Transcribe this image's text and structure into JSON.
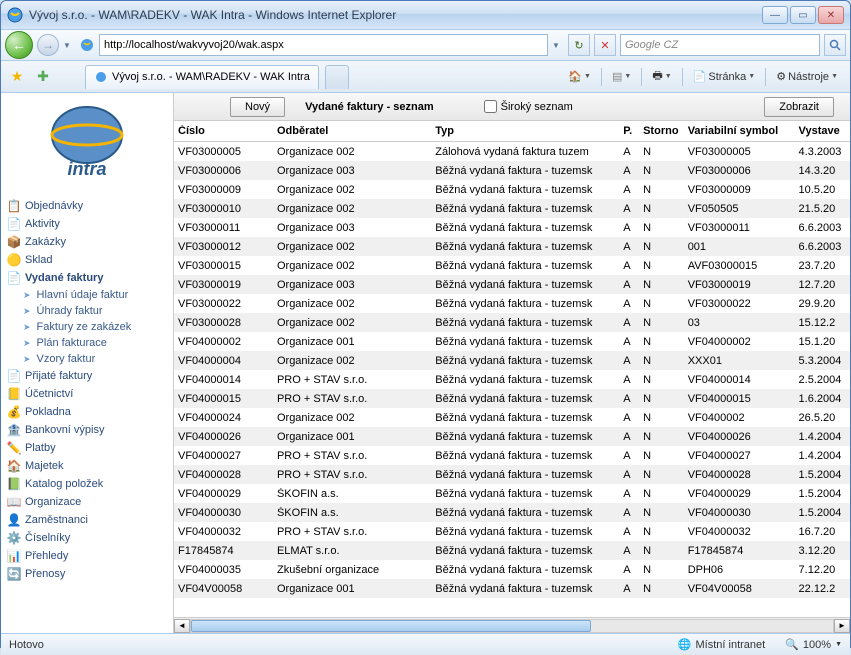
{
  "window": {
    "title": "Vývoj s.r.o. - WAM\\RADEKV - WAK Intra - Windows Internet Explorer"
  },
  "addressbar": {
    "url": "http://localhost/wakvyvoj20/wak.aspx",
    "search_placeholder": "Google CZ"
  },
  "tab": {
    "title": "Vývoj s.r.o. - WAM\\RADEKV - WAK Intra"
  },
  "ie_tools": {
    "stranka": "Stránka",
    "nastroje": "Nástroje"
  },
  "sidebar": {
    "items": [
      {
        "label": "Objednávky",
        "icon": "📋"
      },
      {
        "label": "Aktivity",
        "icon": "📄"
      },
      {
        "label": "Zakázky",
        "icon": "📦"
      },
      {
        "label": "Sklad",
        "icon": "🟡"
      },
      {
        "label": "Vydané faktury",
        "icon": "📄",
        "bold": true,
        "expanded": true,
        "children": [
          {
            "label": "Hlavní údaje faktur"
          },
          {
            "label": "Úhrady faktur"
          },
          {
            "label": "Faktury ze zakázek"
          },
          {
            "label": "Plán fakturace"
          },
          {
            "label": "Vzory faktur"
          }
        ]
      },
      {
        "label": "Přijaté faktury",
        "icon": "📄"
      },
      {
        "label": "Účetnictví",
        "icon": "📒"
      },
      {
        "label": "Pokladna",
        "icon": "💰"
      },
      {
        "label": "Bankovní výpisy",
        "icon": "🏦"
      },
      {
        "label": "Platby",
        "icon": "✏️"
      },
      {
        "label": "Majetek",
        "icon": "🏠"
      },
      {
        "label": "Katalog položek",
        "icon": "📗"
      },
      {
        "label": "Organizace",
        "icon": "📖"
      },
      {
        "label": "Zaměstnanci",
        "icon": "👤"
      },
      {
        "label": "Číselníky",
        "icon": "⚙️"
      },
      {
        "label": "Přehledy",
        "icon": "📊"
      },
      {
        "label": "Přenosy",
        "icon": "🔄"
      }
    ]
  },
  "main": {
    "new_btn": "Nový",
    "title": "Vydané faktury - seznam",
    "wide_check": "Široký seznam",
    "show_btn": "Zobrazit",
    "columns": {
      "cislo": "Číslo",
      "odberatel": "Odběratel",
      "typ": "Typ",
      "p": "P.",
      "storno": "Storno",
      "varsym": "Variabilní symbol",
      "vystaveno": "Vystave"
    },
    "rows": [
      {
        "cislo": "VF03000005",
        "odber": "Organizace 002",
        "typ": "Zálohová vydaná faktura tuzem",
        "p": "A",
        "s": "N",
        "var": "VF03000005",
        "vyst": "4.3.2003"
      },
      {
        "cislo": "VF03000006",
        "odber": "Organizace 003",
        "typ": "Běžná vydaná faktura - tuzemsk",
        "p": "A",
        "s": "N",
        "var": "VF03000006",
        "vyst": "14.3.20"
      },
      {
        "cislo": "VF03000009",
        "odber": "Organizace 002",
        "typ": "Běžná vydaná faktura - tuzemsk",
        "p": "A",
        "s": "N",
        "var": "VF03000009",
        "vyst": "10.5.20"
      },
      {
        "cislo": "VF03000010",
        "odber": "Organizace 002",
        "typ": "Běžná vydaná faktura - tuzemsk",
        "p": "A",
        "s": "N",
        "var": "VF050505",
        "vyst": "21.5.20"
      },
      {
        "cislo": "VF03000011",
        "odber": "Organizace 003",
        "typ": "Běžná vydaná faktura - tuzemsk",
        "p": "A",
        "s": "N",
        "var": "VF03000011",
        "vyst": "6.6.2003"
      },
      {
        "cislo": "VF03000012",
        "odber": "Organizace 002",
        "typ": "Běžná vydaná faktura - tuzemsk",
        "p": "A",
        "s": "N",
        "var": "001",
        "vyst": "6.6.2003"
      },
      {
        "cislo": "VF03000015",
        "odber": "Organizace 002",
        "typ": "Běžná vydaná faktura - tuzemsk",
        "p": "A",
        "s": "N",
        "var": "AVF03000015",
        "vyst": "23.7.20"
      },
      {
        "cislo": "VF03000019",
        "odber": "Organizace 003",
        "typ": "Běžná vydaná faktura - tuzemsk",
        "p": "A",
        "s": "N",
        "var": "VF03000019",
        "vyst": "12.7.20"
      },
      {
        "cislo": "VF03000022",
        "odber": "Organizace 002",
        "typ": "Běžná vydaná faktura - tuzemsk",
        "p": "A",
        "s": "N",
        "var": "VF03000022",
        "vyst": "29.9.20"
      },
      {
        "cislo": "VF03000028",
        "odber": "Organizace 002",
        "typ": "Běžná vydaná faktura - tuzemsk",
        "p": "A",
        "s": "N",
        "var": "03",
        "vyst": "15.12.2"
      },
      {
        "cislo": "VF04000002",
        "odber": "Organizace 001",
        "typ": "Běžná vydaná faktura - tuzemsk",
        "p": "A",
        "s": "N",
        "var": "VF04000002",
        "vyst": "15.1.20"
      },
      {
        "cislo": "VF04000004",
        "odber": "Organizace 002",
        "typ": "Běžná vydaná faktura - tuzemsk",
        "p": "A",
        "s": "N",
        "var": "XXX01",
        "vyst": "5.3.2004"
      },
      {
        "cislo": "VF04000014",
        "odber": "PRO + STAV s.r.o.",
        "typ": "Běžná vydaná faktura - tuzemsk",
        "p": "A",
        "s": "N",
        "var": "VF04000014",
        "vyst": "2.5.2004"
      },
      {
        "cislo": "VF04000015",
        "odber": "PRO + STAV s.r.o.",
        "typ": "Běžná vydaná faktura - tuzemsk",
        "p": "A",
        "s": "N",
        "var": "VF04000015",
        "vyst": "1.6.2004"
      },
      {
        "cislo": "VF04000024",
        "odber": "Organizace 002",
        "typ": "Běžná vydaná faktura - tuzemsk",
        "p": "A",
        "s": "N",
        "var": "VF0400002",
        "vyst": "26.5.20"
      },
      {
        "cislo": "VF04000026",
        "odber": "Organizace 001",
        "typ": "Běžná vydaná faktura - tuzemsk",
        "p": "A",
        "s": "N",
        "var": "VF04000026",
        "vyst": "1.4.2004"
      },
      {
        "cislo": "VF04000027",
        "odber": "PRO + STAV s.r.o.",
        "typ": "Běžná vydaná faktura - tuzemsk",
        "p": "A",
        "s": "N",
        "var": "VF04000027",
        "vyst": "1.4.2004"
      },
      {
        "cislo": "VF04000028",
        "odber": "PRO + STAV s.r.o.",
        "typ": "Běžná vydaná faktura - tuzemsk",
        "p": "A",
        "s": "N",
        "var": "VF04000028",
        "vyst": "1.5.2004"
      },
      {
        "cislo": "VF04000029",
        "odber": "ŠKOFIN a.s.",
        "typ": "Běžná vydaná faktura - tuzemsk",
        "p": "A",
        "s": "N",
        "var": "VF04000029",
        "vyst": "1.5.2004"
      },
      {
        "cislo": "VF04000030",
        "odber": "ŠKOFIN a.s.",
        "typ": "Běžná vydaná faktura - tuzemsk",
        "p": "A",
        "s": "N",
        "var": "VF04000030",
        "vyst": "1.5.2004"
      },
      {
        "cislo": "VF04000032",
        "odber": "PRO + STAV s.r.o.",
        "typ": "Běžná vydaná faktura - tuzemsk",
        "p": "A",
        "s": "N",
        "var": "VF04000032",
        "vyst": "16.7.20"
      },
      {
        "cislo": "F17845874",
        "odber": "ELMAT s.r.o.",
        "typ": "Běžná vydaná faktura - tuzemsk",
        "p": "A",
        "s": "N",
        "var": "F17845874",
        "vyst": "3.12.20"
      },
      {
        "cislo": "VF04000035",
        "odber": "Zkušební organizace",
        "typ": "Běžná vydaná faktura - tuzemsk",
        "p": "A",
        "s": "N",
        "var": "DPH06",
        "vyst": "7.12.20"
      },
      {
        "cislo": "VF04V00058",
        "odber": "Organizace 001",
        "typ": "Běžná vydaná faktura - tuzemsk",
        "p": "A",
        "s": "N",
        "var": "VF04V00058",
        "vyst": "22.12.2"
      }
    ]
  },
  "status": {
    "text": "Hotovo",
    "zone": "Místní intranet",
    "zoom": "100%"
  }
}
